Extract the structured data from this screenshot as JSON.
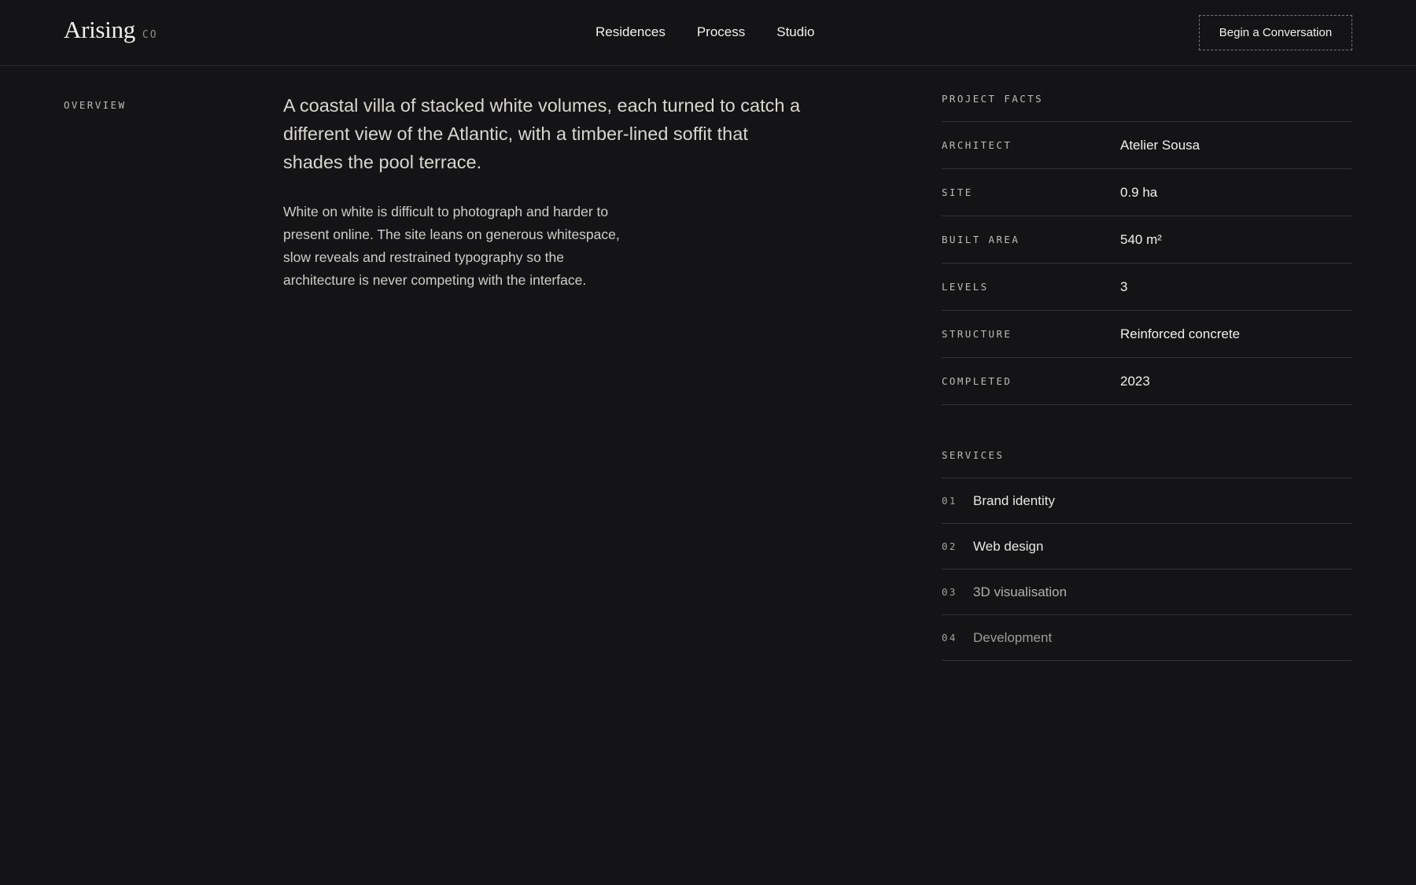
{
  "header": {
    "logo": {
      "main": "Arising",
      "sub": "CO"
    },
    "nav": [
      "Residences",
      "Process",
      "Studio"
    ],
    "cta_label": "Begin a Conversation"
  },
  "overview": {
    "label": "OVERVIEW",
    "lead": "A coastal villa of stacked white volumes, each turned to catch a different view of the Atlantic, with a timber-lined soffit that shades the pool terrace.",
    "body": "White on white is difficult to photograph and harder to present online. The site leans on generous whitespace, slow reveals and restrained typography so the architecture is never competing with the interface."
  },
  "facts": {
    "title": "PROJECT FACTS",
    "rows": [
      {
        "key": "ARCHITECT",
        "value": "Atelier Sousa"
      },
      {
        "key": "SITE",
        "value": "0.9 ha"
      },
      {
        "key": "BUILT AREA",
        "value": "540 m²"
      },
      {
        "key": "LEVELS",
        "value": "3"
      },
      {
        "key": "STRUCTURE",
        "value": "Reinforced concrete"
      },
      {
        "key": "COMPLETED",
        "value": "2023"
      }
    ]
  },
  "services": {
    "title": "SERVICES",
    "items": [
      {
        "num": "01",
        "name": "Brand identity"
      },
      {
        "num": "02",
        "name": "Web design"
      },
      {
        "num": "03",
        "name": "3D visualisation"
      },
      {
        "num": "04",
        "name": "Development"
      }
    ]
  }
}
